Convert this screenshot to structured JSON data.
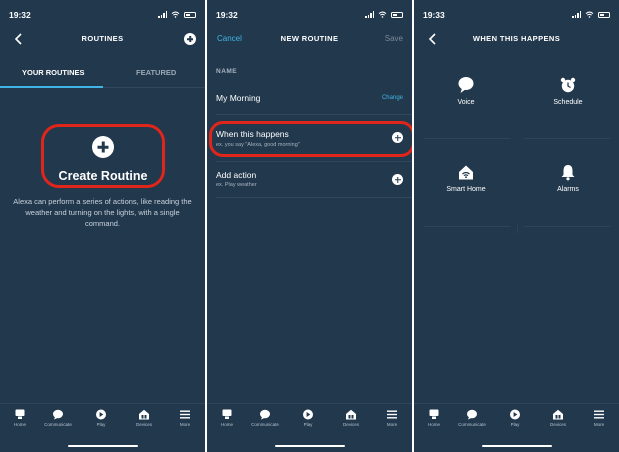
{
  "colors": {
    "background": "#22384d",
    "accent": "#40b4e5",
    "highlight": "#e0251b"
  },
  "bottom_nav": [
    {
      "label": "Home",
      "icon": "home-icon"
    },
    {
      "label": "Communicate",
      "icon": "chat-bubble-icon"
    },
    {
      "label": "Play",
      "icon": "play-icon"
    },
    {
      "label": "Devices",
      "icon": "devices-icon"
    },
    {
      "label": "More",
      "icon": "menu-icon"
    }
  ],
  "screens": [
    {
      "status": {
        "time": "19:32"
      },
      "nav": {
        "title": "ROUTINES"
      },
      "tabs": {
        "yours": "YOUR ROUTINES",
        "featured": "FEATURED"
      },
      "create": {
        "label": "Create Routine",
        "description": "Alexa can perform a series of actions, like reading the weather and turning on the lights, with a single command."
      }
    },
    {
      "status": {
        "time": "19:32"
      },
      "nav": {
        "title": "NEW ROUTINE",
        "cancel": "Cancel",
        "save": "Save"
      },
      "name_section": {
        "label": "NAME",
        "value": "My Morning",
        "change": "Change"
      },
      "when": {
        "title": "When this happens",
        "subtitle": "ex. you say \"Alexa, good morning\""
      },
      "action": {
        "title": "Add action",
        "subtitle": "ex. Play weather"
      }
    },
    {
      "status": {
        "time": "19:33"
      },
      "nav": {
        "title": "WHEN THIS HAPPENS"
      },
      "options": [
        {
          "label": "Voice",
          "icon": "speech-bubble-icon"
        },
        {
          "label": "Schedule",
          "icon": "alarm-clock-icon"
        },
        {
          "label": "Smart Home",
          "icon": "smart-home-icon"
        },
        {
          "label": "Alarms",
          "icon": "bell-icon"
        }
      ]
    }
  ]
}
